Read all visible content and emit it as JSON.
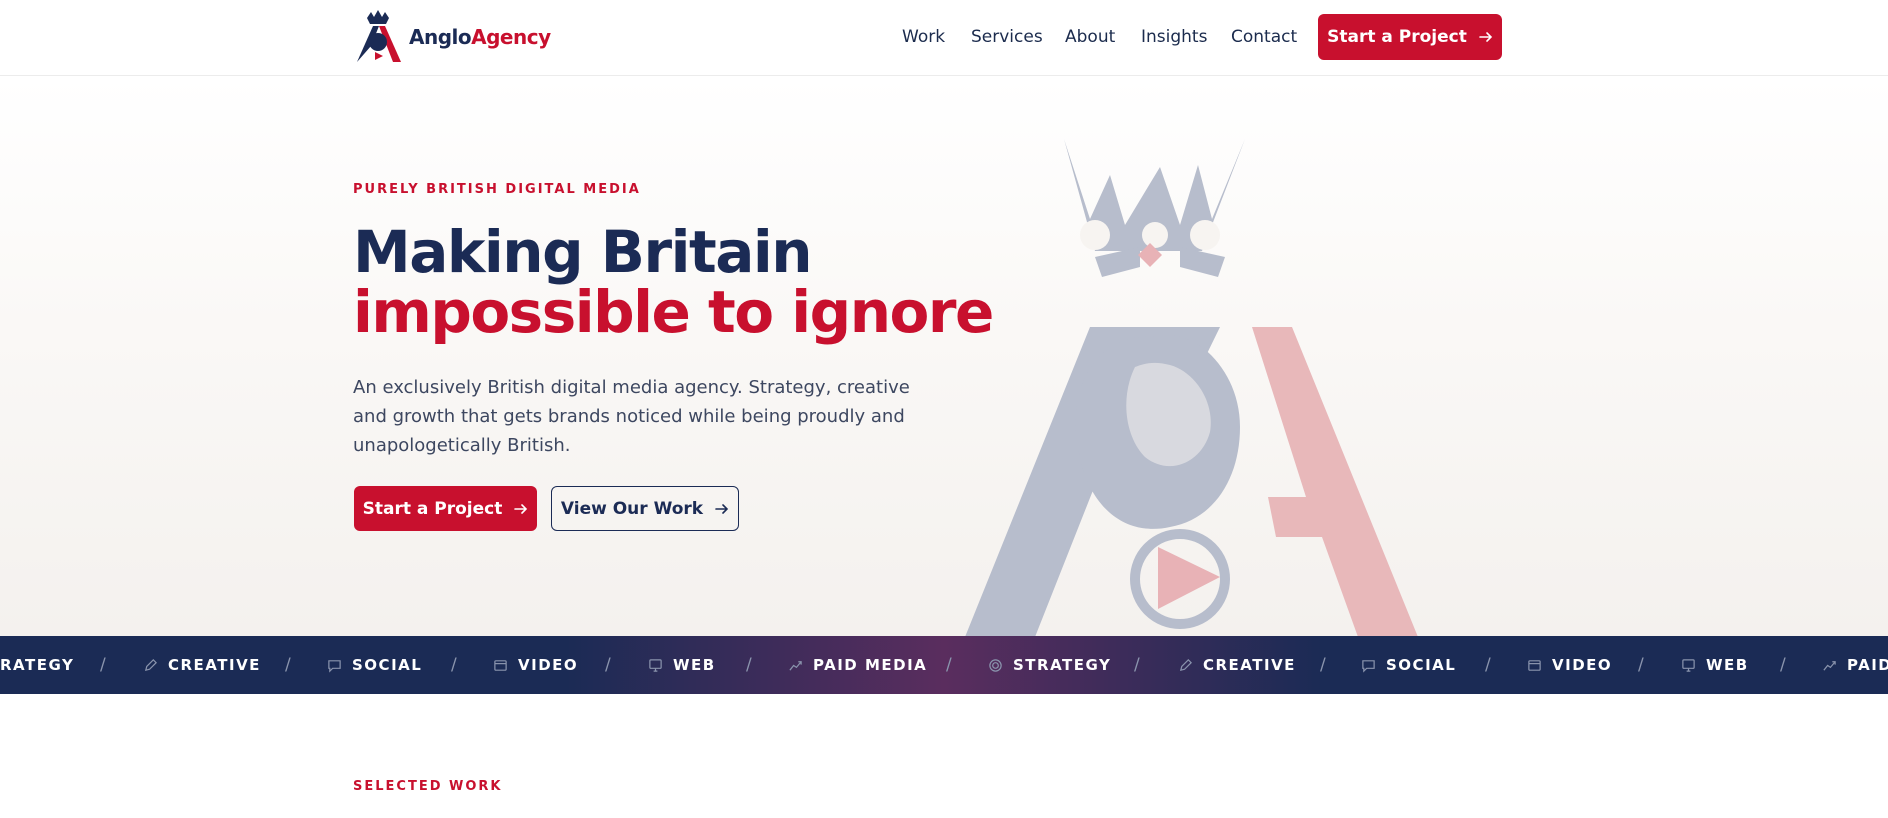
{
  "brand": {
    "name_part1": "Anglo",
    "name_part2": "Agency",
    "colors": {
      "navy": "#1b2b55",
      "red": "#c8102e"
    }
  },
  "nav": {
    "items": [
      "Work",
      "Services",
      "About",
      "Insights",
      "Contact"
    ],
    "cta_label": "Start a Project"
  },
  "hero": {
    "eyebrow": "PURELY BRITISH DIGITAL MEDIA",
    "title_line1": "Making Britain",
    "title_line2": "impossible to ignore",
    "description": "An exclusively British digital media agency. Strategy, creative and growth that gets brands noticed while being proudly and unapologetically British.",
    "primary_cta": "Start a Project",
    "secondary_cta": "View Our Work"
  },
  "ticker": {
    "items": [
      {
        "label": "RATEGY",
        "icon": "target-icon"
      },
      {
        "label": "CREATIVE",
        "icon": "pencil-icon"
      },
      {
        "label": "SOCIAL",
        "icon": "chat-icon"
      },
      {
        "label": "VIDEO",
        "icon": "video-icon"
      },
      {
        "label": "WEB",
        "icon": "monitor-icon"
      },
      {
        "label": "PAID MEDIA",
        "icon": "chart-icon"
      },
      {
        "label": "STRATEGY",
        "icon": "target-icon"
      },
      {
        "label": "CREATIVE",
        "icon": "pencil-icon"
      },
      {
        "label": "SOCIAL",
        "icon": "chat-icon"
      },
      {
        "label": "VIDEO",
        "icon": "video-icon"
      },
      {
        "label": "WEB",
        "icon": "monitor-icon"
      },
      {
        "label": "PAID",
        "icon": "chart-icon"
      }
    ],
    "separator": "/"
  },
  "selected_work": {
    "eyebrow": "SELECTED WORK"
  }
}
